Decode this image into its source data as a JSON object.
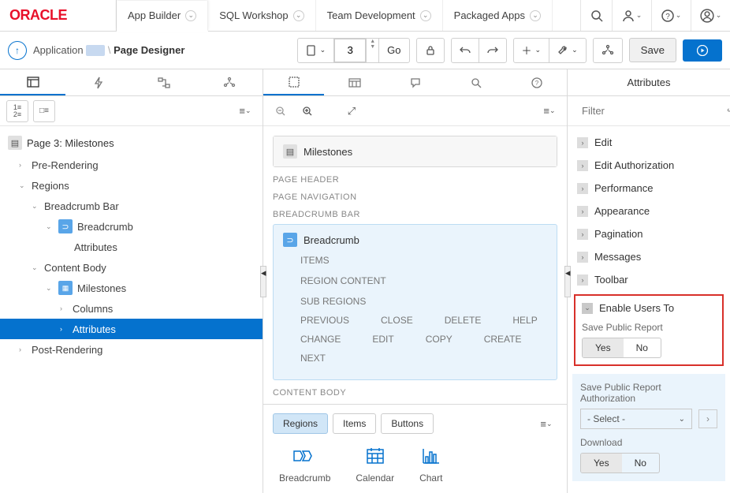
{
  "logo": "ORACLE",
  "topnav": [
    "App Builder",
    "SQL Workshop",
    "Team Development",
    "Packaged Apps"
  ],
  "breadcrumb": {
    "app": "Application",
    "page_designer": "Page Designer"
  },
  "toolbar": {
    "page_number": "3",
    "go": "Go",
    "save": "Save"
  },
  "tree": {
    "page_title": "Page 3: Milestones",
    "pre_rendering": "Pre-Rendering",
    "regions": "Regions",
    "breadcrumb_bar": "Breadcrumb Bar",
    "breadcrumb": "Breadcrumb",
    "attributes1": "Attributes",
    "content_body": "Content Body",
    "milestones": "Milestones",
    "columns": "Columns",
    "attributes2": "Attributes",
    "post_rendering": "Post-Rendering"
  },
  "center": {
    "milestones": "Milestones",
    "page_header": "PAGE HEADER",
    "page_navigation": "PAGE NAVIGATION",
    "breadcrumb_bar": "BREADCRUMB BAR",
    "breadcrumb": "Breadcrumb",
    "items": "ITEMS",
    "region_content": "REGION CONTENT",
    "sub_regions": "SUB REGIONS",
    "previous": "PREVIOUS",
    "close": "CLOSE",
    "delete": "DELETE",
    "help": "HELP",
    "change": "CHANGE",
    "edit": "EDIT",
    "copy": "COPY",
    "create": "CREATE",
    "next": "NEXT",
    "content_body": "CONTENT BODY"
  },
  "gallery": {
    "regions": "Regions",
    "items": "Items",
    "buttons": "Buttons",
    "breadcrumb": "Breadcrumb",
    "calendar": "Calendar",
    "chart": "Chart"
  },
  "right": {
    "header": "Attributes",
    "filter_placeholder": "Filter",
    "groups": [
      "Edit",
      "Edit Authorization",
      "Performance",
      "Appearance",
      "Pagination",
      "Messages",
      "Toolbar"
    ],
    "enable_users_to": "Enable Users To",
    "save_public_report": "Save Public Report",
    "yes": "Yes",
    "no": "No",
    "save_public_report_auth": "Save Public Report Authorization",
    "select_placeholder": "- Select -",
    "download": "Download"
  }
}
